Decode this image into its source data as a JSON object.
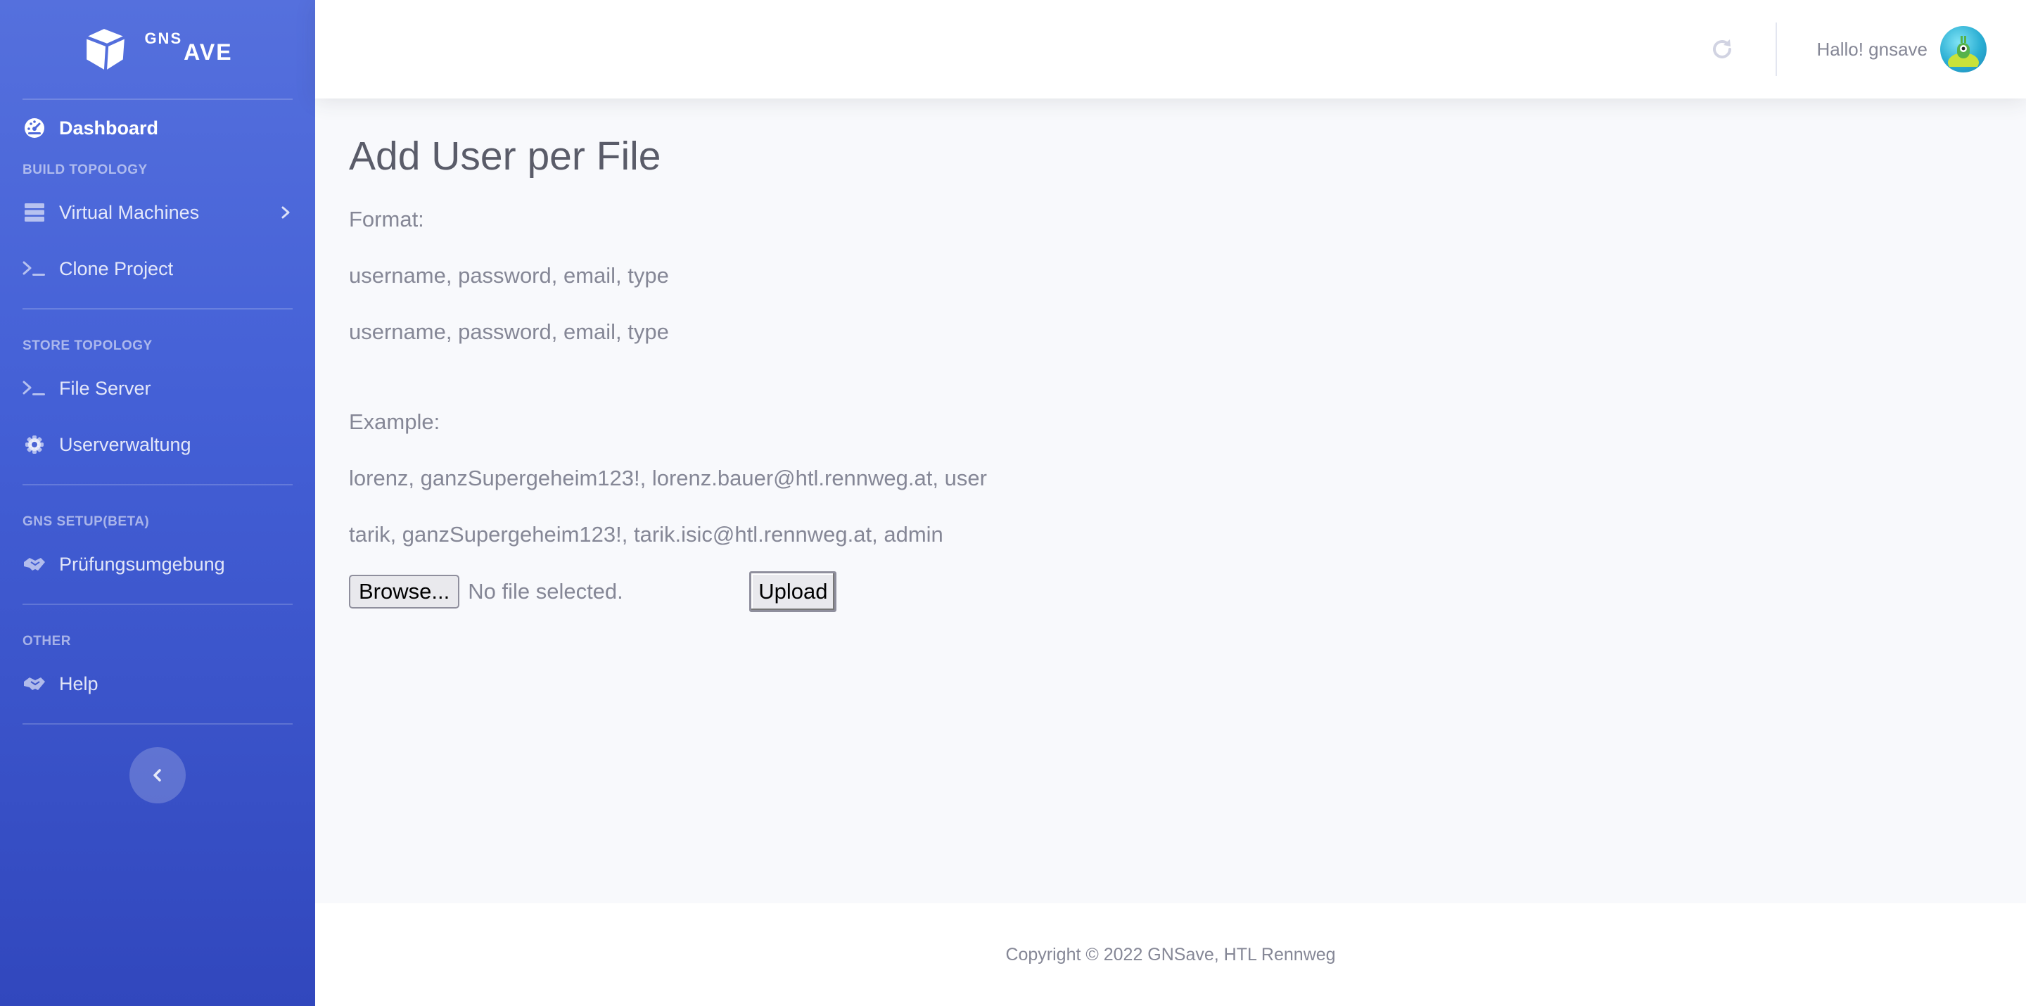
{
  "brand": {
    "sup": "GNS",
    "main": "AVE"
  },
  "sidebar": {
    "dashboard": "Dashboard",
    "sections": {
      "build": "BUILD TOPOLOGY",
      "store": "STORE TOPOLOGY",
      "gns": "GNS SETUP(BETA)",
      "other": "OTHER"
    },
    "items": {
      "virtual_machines": "Virtual Machines",
      "clone_project": "Clone Project",
      "file_server": "File Server",
      "userverwaltung": "Userverwaltung",
      "pruefungsumgebung": "Prüfungsumgebung",
      "help": "Help"
    }
  },
  "topbar": {
    "greeting": "Hallo! gnsave"
  },
  "main": {
    "title": "Add User per File",
    "format_label": "Format:",
    "format_lines": [
      "username, password, email, type",
      "username, password, email, type"
    ],
    "example_label": "Example:",
    "example_lines": [
      "lorenz, ganzSupergeheim123!, lorenz.bauer@htl.rennweg.at, user",
      "tarik, ganzSupergeheim123!, tarik.isic@htl.rennweg.at, admin"
    ],
    "browse_label": "Browse...",
    "file_status": "No file selected.",
    "upload_label": "Upload"
  },
  "footer": {
    "copyright": "Copyright © 2022 GNSave, HTL Rennweg"
  },
  "colors": {
    "sidebar_top": "#5570dd",
    "sidebar_bottom": "#3147bd",
    "text_muted": "#858796",
    "title": "#5a5c69"
  },
  "icons": {
    "logo": "cube-logo-icon",
    "dashboard": "tachometer-icon",
    "virtual_machines": "server-icon",
    "clone_project": "terminal-icon",
    "file_server": "terminal-icon",
    "userverwaltung": "gear-icon",
    "pruefungsumgebung": "handshake-icon",
    "help": "handshake-icon",
    "refresh": "refresh-icon",
    "collapse": "chevron-left-icon"
  }
}
